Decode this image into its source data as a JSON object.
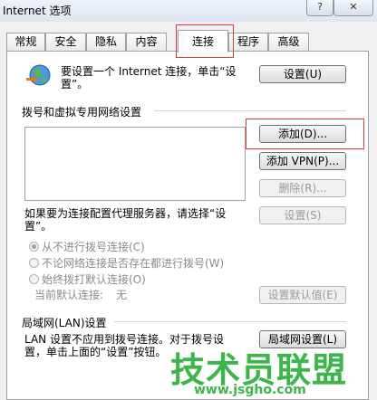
{
  "window": {
    "title": "Internet 选项",
    "help_label": "?",
    "close_label": "✕"
  },
  "tabs": [
    "常规",
    "安全",
    "隐私",
    "内容",
    "连接",
    "程序",
    "高级"
  ],
  "active_tab": "连接",
  "setup": {
    "text_line1": "要设置一个 Internet 连接，单击“设",
    "text_line2": "置”。",
    "button": "设置(U)"
  },
  "dialup": {
    "group_title": "拨号和虚拟专用网络设置",
    "add_button": "添加(D)...",
    "add_vpn_button": "添加 VPN(P)...",
    "remove_button": "删除(R)...",
    "proxy_text_line1": "如果要为连接配置代理服务器，请选择“设",
    "proxy_text_line2": "置”。",
    "settings_button": "设置(S)",
    "radio_never": "从不进行拨号连接(C)",
    "radio_when_none": "不论网络连接是否存在都进行拨号(W)",
    "radio_always": "始终拨打默认连接(O)",
    "current_default_label": "当前默认连接:",
    "current_default_value": "无",
    "set_default_button": "设置默认值(E)"
  },
  "lan": {
    "group_title": "局域网(LAN)设置",
    "text_line1": "LAN 设置不应用到拨号连接。对于拨号设",
    "text_line2": "置，单击上面的“设置”按钮。",
    "button": "局域网设置(L)"
  },
  "watermark": {
    "brand": "技术员联盟",
    "url": "www.jsgho.com"
  },
  "colors": {
    "highlight": "#e23a3a",
    "watermark": "#3cb648"
  }
}
